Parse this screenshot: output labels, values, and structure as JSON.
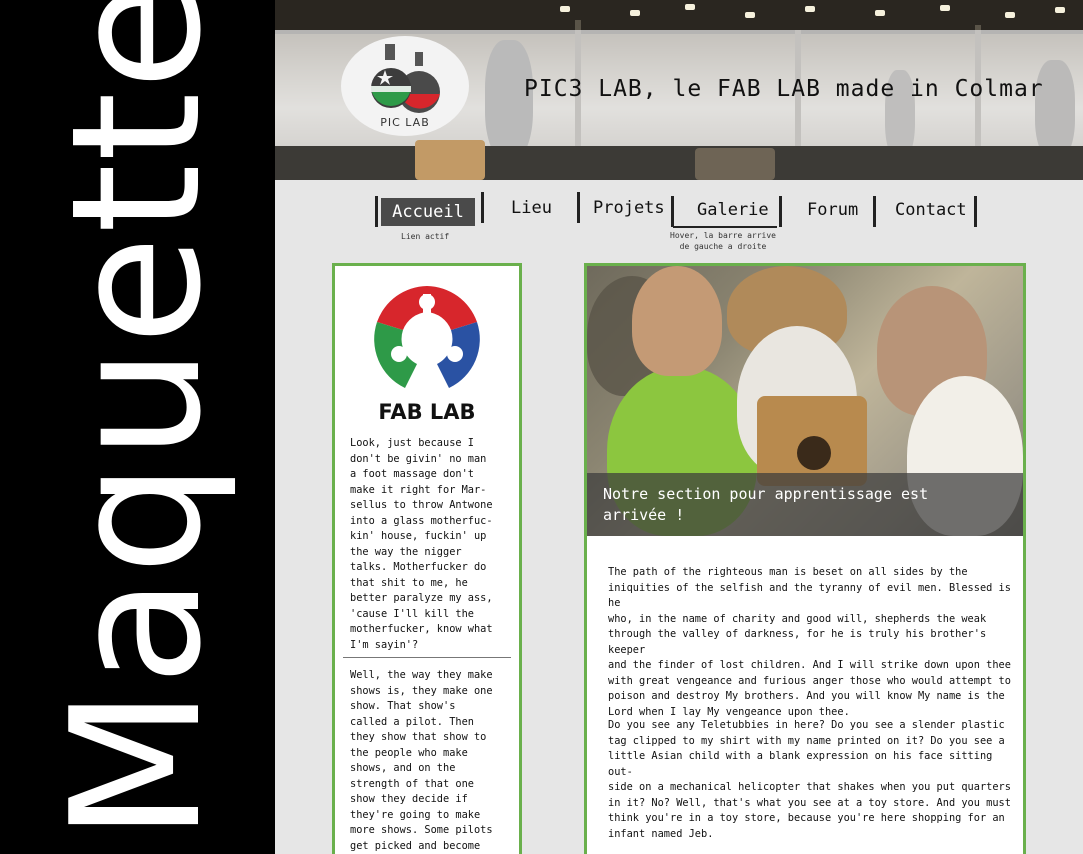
{
  "side_title": "Maquette",
  "header": {
    "logo_text": "PIC LAB",
    "site_title": "PIC3 LAB, le FAB LAB made in Colmar"
  },
  "nav": {
    "items": [
      "Accueil",
      "Lieu",
      "Projets",
      "Galerie",
      "Forum",
      "Contact"
    ],
    "active_note": "Lien actif",
    "hover_note_line1": "Hover, la barre arrive",
    "hover_note_line2": "de gauche a droite"
  },
  "sidebar": {
    "logo_text": "FAB LAB",
    "paragraph1": "Look, just because I\ndon't be givin' no man\na foot massage don't\nmake it right for Mar-\nsellus to throw Antwone\ninto a glass motherfuc-\nkin' house, fuckin' up\nthe way the nigger\ntalks. Motherfucker do\nthat shit to me, he\nbetter paralyze my ass,\n'cause I'll kill the\nmotherfucker, know what\nI'm sayin'?",
    "paragraph2": "Well, the way they make\nshows is, they make one\nshow. That show's\ncalled a pilot. Then\nthey show that show to\nthe people who make\nshows, and on the\nstrength of that one\nshow they decide if\nthey're going to make\nmore shows. Some pilots\nget picked and become"
  },
  "main": {
    "hero_caption": "Notre section pour apprentissage est\narrivée !",
    "paragraph1": "The path of the righteous man is beset on all sides by the\niniquities of the selfish and the tyranny of evil men. Blessed is he\nwho, in the name of charity and good will, shepherds the weak\nthrough the valley of darkness, for he is truly his brother's keeper\nand the finder of lost children. And I will strike down upon thee\nwith great vengeance and furious anger those who would attempt to\npoison and destroy My brothers. And you will know My name is the\nLord when I lay My vengeance upon thee.",
    "paragraph2": "Do you see any Teletubbies in here? Do you see a slender plastic\ntag clipped to my shirt with my name printed on it? Do you see a\nlittle Asian child with a blank expression on his face sitting out-\nside on a mechanical helicopter that shakes when you put quarters\nin it? No? Well, that's what you see at a toy store. And you must\nthink you're in a toy store, because you're here shopping for an\ninfant named Jeb."
  },
  "colors": {
    "side_band": "#000000",
    "accent_green": "#6ab04c",
    "active_nav_bg": "#4a4a4a",
    "fablab_red": "#d7262c",
    "fablab_green": "#2e9a48",
    "fablab_blue": "#2a52a3"
  },
  "icons": [
    "pic-lab-flask-logo",
    "fablab-logo"
  ]
}
